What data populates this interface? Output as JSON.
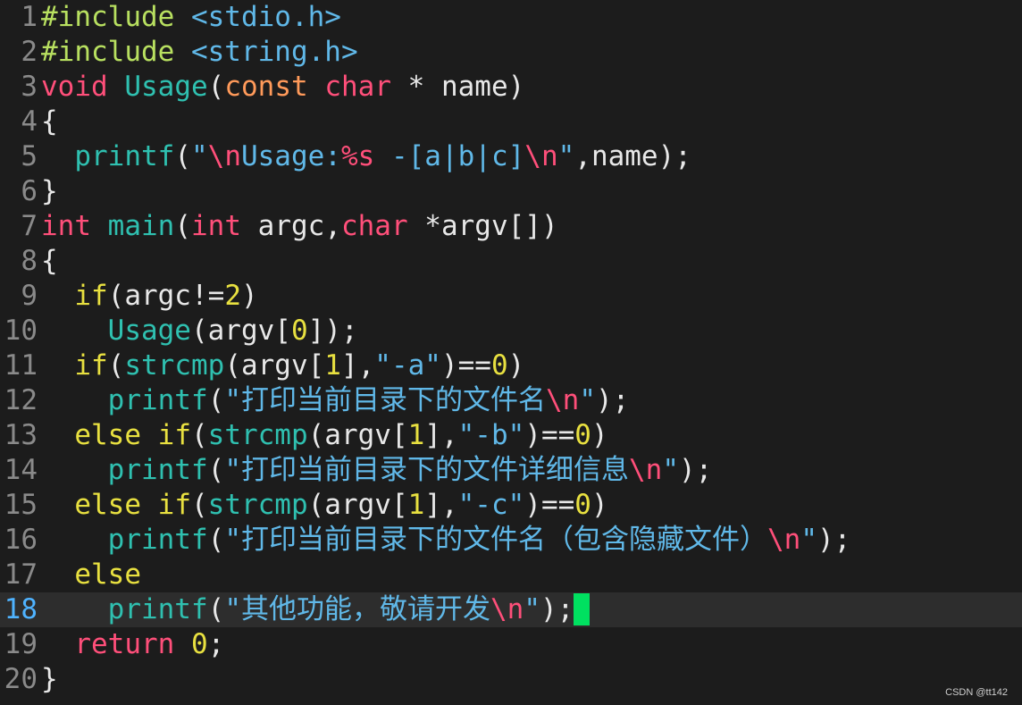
{
  "editor": {
    "current_line": 18,
    "lines": [
      {
        "num": "1",
        "tokens": [
          {
            "t": "#include ",
            "c": "pre"
          },
          {
            "t": "<stdio.h>",
            "c": "inc"
          }
        ]
      },
      {
        "num": "2",
        "tokens": [
          {
            "t": "#include ",
            "c": "pre"
          },
          {
            "t": "<string.h>",
            "c": "inc"
          }
        ]
      },
      {
        "num": "3",
        "tokens": [
          {
            "t": "void",
            "c": "kw"
          },
          {
            "t": " ",
            "c": "txt"
          },
          {
            "t": "Usage",
            "c": "fn"
          },
          {
            "t": "(",
            "c": "txt"
          },
          {
            "t": "const",
            "c": "par"
          },
          {
            "t": " ",
            "c": "txt"
          },
          {
            "t": "char",
            "c": "kw"
          },
          {
            "t": " * name)",
            "c": "txt"
          }
        ]
      },
      {
        "num": "4",
        "tokens": [
          {
            "t": "{",
            "c": "txt"
          }
        ]
      },
      {
        "num": "5",
        "tokens": [
          {
            "t": "  ",
            "c": "txt"
          },
          {
            "t": "printf",
            "c": "fn"
          },
          {
            "t": "(",
            "c": "txt"
          },
          {
            "t": "\"",
            "c": "str"
          },
          {
            "t": "\\n",
            "c": "esc"
          },
          {
            "t": "Usage:",
            "c": "str"
          },
          {
            "t": "%s",
            "c": "esc"
          },
          {
            "t": " -[a|b|c]",
            "c": "str"
          },
          {
            "t": "\\n",
            "c": "esc"
          },
          {
            "t": "\"",
            "c": "str"
          },
          {
            "t": ",name);",
            "c": "txt"
          }
        ]
      },
      {
        "num": "6",
        "tokens": [
          {
            "t": "}",
            "c": "txt"
          }
        ]
      },
      {
        "num": "7",
        "tokens": [
          {
            "t": "int",
            "c": "kw"
          },
          {
            "t": " ",
            "c": "txt"
          },
          {
            "t": "main",
            "c": "fn"
          },
          {
            "t": "(",
            "c": "txt"
          },
          {
            "t": "int",
            "c": "kw"
          },
          {
            "t": " argc,",
            "c": "txt"
          },
          {
            "t": "char",
            "c": "kw"
          },
          {
            "t": " *argv[])",
            "c": "txt"
          }
        ]
      },
      {
        "num": "8",
        "tokens": [
          {
            "t": "{",
            "c": "txt"
          }
        ]
      },
      {
        "num": "9",
        "tokens": [
          {
            "t": "  ",
            "c": "txt"
          },
          {
            "t": "if",
            "c": "ctl"
          },
          {
            "t": "(argc!=",
            "c": "txt"
          },
          {
            "t": "2",
            "c": "num"
          },
          {
            "t": ")",
            "c": "txt"
          }
        ]
      },
      {
        "num": "10",
        "tokens": [
          {
            "t": "    ",
            "c": "txt"
          },
          {
            "t": "Usage",
            "c": "fn"
          },
          {
            "t": "(argv[",
            "c": "txt"
          },
          {
            "t": "0",
            "c": "num"
          },
          {
            "t": "]);",
            "c": "txt"
          }
        ]
      },
      {
        "num": "11",
        "tokens": [
          {
            "t": "  ",
            "c": "txt"
          },
          {
            "t": "if",
            "c": "ctl"
          },
          {
            "t": "(",
            "c": "txt"
          },
          {
            "t": "strcmp",
            "c": "fn"
          },
          {
            "t": "(argv[",
            "c": "txt"
          },
          {
            "t": "1",
            "c": "num"
          },
          {
            "t": "],",
            "c": "txt"
          },
          {
            "t": "\"-a\"",
            "c": "str"
          },
          {
            "t": ")==",
            "c": "txt"
          },
          {
            "t": "0",
            "c": "num"
          },
          {
            "t": ")",
            "c": "txt"
          }
        ]
      },
      {
        "num": "12",
        "tokens": [
          {
            "t": "    ",
            "c": "txt"
          },
          {
            "t": "printf",
            "c": "fn"
          },
          {
            "t": "(",
            "c": "txt"
          },
          {
            "t": "\"打印当前目录下的文件名",
            "c": "str"
          },
          {
            "t": "\\n",
            "c": "esc"
          },
          {
            "t": "\"",
            "c": "str"
          },
          {
            "t": ");",
            "c": "txt"
          }
        ]
      },
      {
        "num": "13",
        "tokens": [
          {
            "t": "  ",
            "c": "txt"
          },
          {
            "t": "else",
            "c": "ctl"
          },
          {
            "t": " ",
            "c": "txt"
          },
          {
            "t": "if",
            "c": "ctl"
          },
          {
            "t": "(",
            "c": "txt"
          },
          {
            "t": "strcmp",
            "c": "fn"
          },
          {
            "t": "(argv[",
            "c": "txt"
          },
          {
            "t": "1",
            "c": "num"
          },
          {
            "t": "],",
            "c": "txt"
          },
          {
            "t": "\"-b\"",
            "c": "str"
          },
          {
            "t": ")==",
            "c": "txt"
          },
          {
            "t": "0",
            "c": "num"
          },
          {
            "t": ")",
            "c": "txt"
          }
        ]
      },
      {
        "num": "14",
        "tokens": [
          {
            "t": "    ",
            "c": "txt"
          },
          {
            "t": "printf",
            "c": "fn"
          },
          {
            "t": "(",
            "c": "txt"
          },
          {
            "t": "\"打印当前目录下的文件详细信息",
            "c": "str"
          },
          {
            "t": "\\n",
            "c": "esc"
          },
          {
            "t": "\"",
            "c": "str"
          },
          {
            "t": ");",
            "c": "txt"
          }
        ]
      },
      {
        "num": "15",
        "tokens": [
          {
            "t": "  ",
            "c": "txt"
          },
          {
            "t": "else",
            "c": "ctl"
          },
          {
            "t": " ",
            "c": "txt"
          },
          {
            "t": "if",
            "c": "ctl"
          },
          {
            "t": "(",
            "c": "txt"
          },
          {
            "t": "strcmp",
            "c": "fn"
          },
          {
            "t": "(argv[",
            "c": "txt"
          },
          {
            "t": "1",
            "c": "num"
          },
          {
            "t": "],",
            "c": "txt"
          },
          {
            "t": "\"-c\"",
            "c": "str"
          },
          {
            "t": ")==",
            "c": "txt"
          },
          {
            "t": "0",
            "c": "num"
          },
          {
            "t": ")",
            "c": "txt"
          }
        ]
      },
      {
        "num": "16",
        "tokens": [
          {
            "t": "    ",
            "c": "txt"
          },
          {
            "t": "printf",
            "c": "fn"
          },
          {
            "t": "(",
            "c": "txt"
          },
          {
            "t": "\"打印当前目录下的文件名（包含隐藏文件）",
            "c": "str"
          },
          {
            "t": "\\n",
            "c": "esc"
          },
          {
            "t": "\"",
            "c": "str"
          },
          {
            "t": ");",
            "c": "txt"
          }
        ]
      },
      {
        "num": "17",
        "tokens": [
          {
            "t": "  ",
            "c": "txt"
          },
          {
            "t": "else",
            "c": "ctl"
          }
        ]
      },
      {
        "num": "18",
        "tokens": [
          {
            "t": "    ",
            "c": "txt"
          },
          {
            "t": "printf",
            "c": "fn"
          },
          {
            "t": "(",
            "c": "txt"
          },
          {
            "t": "\"其他功能，敬请开发",
            "c": "str"
          },
          {
            "t": "\\n",
            "c": "esc"
          },
          {
            "t": "\"",
            "c": "str"
          },
          {
            "t": ");",
            "c": "txt"
          }
        ],
        "cursor": true
      },
      {
        "num": "19",
        "tokens": [
          {
            "t": "  ",
            "c": "txt"
          },
          {
            "t": "return",
            "c": "kw"
          },
          {
            "t": " ",
            "c": "txt"
          },
          {
            "t": "0",
            "c": "num"
          },
          {
            "t": ";",
            "c": "txt"
          }
        ]
      },
      {
        "num": "20",
        "tokens": [
          {
            "t": "}",
            "c": "txt"
          }
        ]
      }
    ]
  },
  "watermark": "CSDN @tt142",
  "colors": {
    "background": "#1c1c1c",
    "current_line_bg": "#2d2d2d",
    "cursor": "#00e060",
    "keyword": "#ff4f7a",
    "function": "#2fc0b0",
    "string": "#60b8e8",
    "number": "#e8e040"
  }
}
